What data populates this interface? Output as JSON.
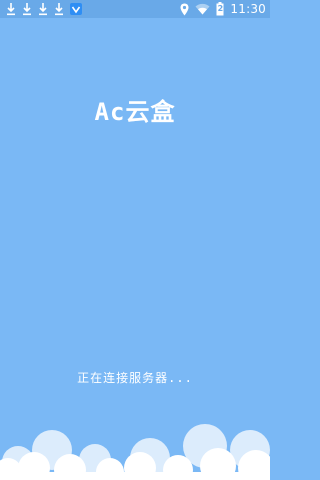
{
  "status_bar": {
    "time": "11:30",
    "battery_label": "2",
    "icons": [
      "download-icon",
      "download-icon",
      "download-icon",
      "download-icon",
      "app-notification-icon",
      "location-icon",
      "wifi-icon",
      "battery-icon"
    ]
  },
  "splash": {
    "app_name": "Ac云盒",
    "status_message": "正在连接服务器..."
  },
  "colors": {
    "background": "#7ab8f5",
    "status_bar": "#69a9e8",
    "cloud": "#ffffff",
    "cloud_shade": "#dcecfc"
  }
}
